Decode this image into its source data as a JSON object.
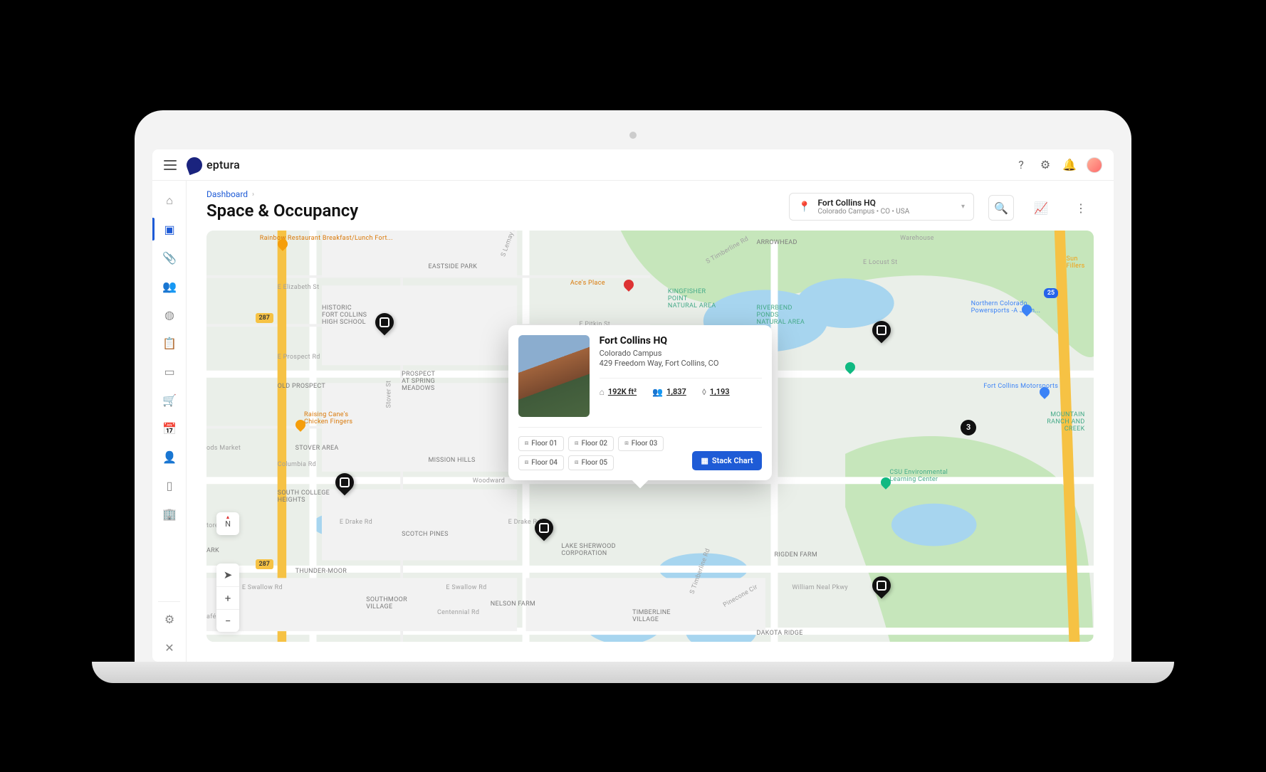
{
  "brand": "eptura",
  "breadcrumb": "Dashboard",
  "page_title": "Space & Occupancy",
  "location_picker": {
    "name": "Fort Collins HQ",
    "path": "Colorado Campus • CO • USA"
  },
  "popup": {
    "title": "Fort Collins HQ",
    "campus": "Colorado Campus",
    "address": "429 Freedom Way, Fort Collins, CO",
    "area": "192K ft²",
    "people": "1,837",
    "seats": "1,193",
    "floors": [
      "Floor 01",
      "Floor 02",
      "Floor 03",
      "Floor 04",
      "Floor 05"
    ],
    "stack_chart": "Stack Chart"
  },
  "map_markers_count_badge": "3",
  "map_labels": {
    "arrowhead": "Arrowhead",
    "eastside": "EASTSIDE PARK",
    "historic": "HISTORIC\nFORT COLLINS\nHIGH SCHOOL",
    "prospect": "PROSPECT\nAT SPRING\nMEADOWS",
    "old_prospect": "OLD PROSPECT",
    "stover": "STOVER AREA",
    "mission": "MISSION HILLS",
    "south_college": "SOUTH COLLEGE\nHEIGHTS",
    "scotch": "SCOTCH PINES",
    "thunder": "THUNDER-MOOR",
    "southmoor": "SOUTHMOOR\nVILLAGE",
    "nelson": "NELSON FARM",
    "lake_sherwood": "LAKE SHERWOOD\nCORPORATION",
    "timberline": "TIMBERLINE\nVILLAGE",
    "rigden": "RIGDEN FARM",
    "dakota": "DAKOTA RIDGE",
    "woodward": "Woodward",
    "kingfisher": "Kingfisher\nPoint\nNatural Area",
    "riverbend": "Riverbend\nPonds\nNatural Area",
    "mountain": "Mountain\nRanch and\nCreek",
    "rainbow": "Rainbow Restaurant\nBreakfast/Lunch Fort...",
    "raising": "Raising Cane's\nChicken Fingers",
    "aces": "Ace's Place",
    "ncps": "Northern Colorado\nPowersports -A John...",
    "fcm": "Fort Collins Motorsports",
    "csu": "CSU Environmental\nLearning Center",
    "sun": "Sun\nFillers",
    "ods": "ods Market",
    "tores": "tores",
    "afe": "afé",
    "ark": "ARK",
    "locust": "E Locust St",
    "elizabeth": "E Elizabeth St",
    "pitkin": "E Pitkin St",
    "prospect_rd": "E Prospect Rd",
    "columbia": "Columbia Rd",
    "edrake": "E Drake Rd",
    "edrake2": "E Drake Rd",
    "eswallow": "E Swallow Rd",
    "eswallow2": "E Swallow Rd",
    "centennial": "Centennial Rd",
    "wneal": "William Neal Pkwy",
    "slemay": "S Lemay Ave",
    "stimberline": "S Timberline Rd",
    "stimberline2": "S Timberline Rd",
    "stover_st": "Stover St",
    "pinecone": "Pinecone Cir",
    "warehouse": "Warehouse",
    "hwy287_1": "287",
    "hwy287_2": "287",
    "i25": "25"
  },
  "compass": "N"
}
